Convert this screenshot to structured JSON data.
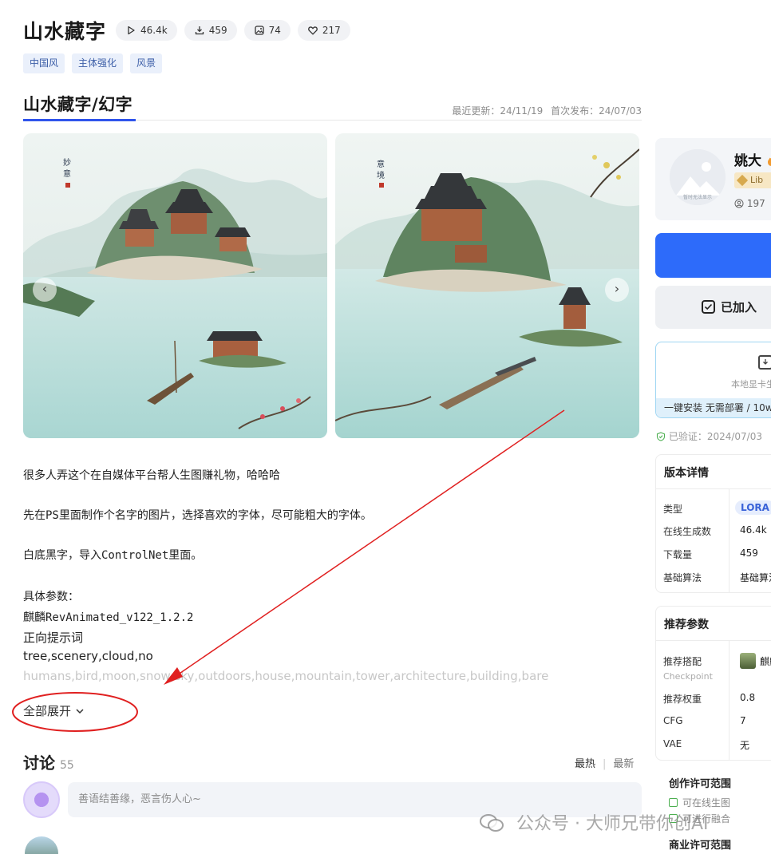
{
  "header": {
    "title": "山水藏字",
    "stats": [
      {
        "icon": "play-icon",
        "value": "46.4k"
      },
      {
        "icon": "download-icon",
        "value": "459"
      },
      {
        "icon": "image-icon",
        "value": "74"
      },
      {
        "icon": "heart-icon",
        "value": "217"
      }
    ],
    "tags": [
      "中国风",
      "主体强化",
      "风景"
    ]
  },
  "version": {
    "tab": "山水藏字/幻字",
    "updated": "最近更新：24/11/19",
    "published": "首次发布：24/07/03"
  },
  "gallery": {
    "prev": "‹",
    "next": "›"
  },
  "description": {
    "lines": [
      "很多人弄这个在自媒体平台帮人生图赚礼物，哈哈哈",
      "先在PS里面制作个名字的图片，选择喜欢的字体，尽可能粗大的字体。",
      "白底黑字，导入ControlNet里面。",
      "具体参数：",
      "麒麟RevAnimated_v122_1.2.2",
      "正向提示词",
      "tree,scenery,cloud,no",
      "humans,bird,moon,snow,sky,outdoors,house,mountain,tower,architecture,building,bare"
    ],
    "expand": "全部展开"
  },
  "discussion": {
    "title": "讨论",
    "count": "55",
    "sort_hot": "最热",
    "sort_sep": "|",
    "sort_new": "最新",
    "placeholder": "善语结善缘，恶言伤人心~"
  },
  "author": {
    "name": "姚大",
    "badge": "Lib",
    "fans": "197",
    "avatar_caption": "暂时无法显示"
  },
  "actions": {
    "joined": "已加入",
    "local_text": "本地显卡生",
    "local_strip": "一键安装 无需部署 / 10w",
    "verified": "已验证：2024/07/03"
  },
  "version_details": {
    "title": "版本详情",
    "rows": [
      {
        "key": "类型",
        "value": "LORA"
      },
      {
        "key": "在线生成数",
        "value": "46.4k"
      },
      {
        "key": "下载量",
        "value": "459"
      },
      {
        "key": "基础算法",
        "value": "基础算法"
      }
    ]
  },
  "recommend": {
    "title": "推荐参数",
    "pairing_key": "推荐搭配",
    "pairing_sub": "Checkpoint",
    "pairing_value": "麒麟",
    "rows": [
      {
        "key": "推荐权重",
        "value": "0.8"
      },
      {
        "key": "CFG",
        "value": "7"
      },
      {
        "key": "VAE",
        "value": "无"
      }
    ]
  },
  "license": {
    "create_title": "创作许可范围",
    "create_items": [
      "可在线生图",
      "可进行融合"
    ],
    "commercial_title": "商业许可范围"
  },
  "watermark": "公众号 · 大师兄带你创AI",
  "colors": {
    "accent": "#2f54eb",
    "primary_button": "#2d6bfa",
    "annotation": "#e02020",
    "tag_bg": "#eaf0fb"
  }
}
